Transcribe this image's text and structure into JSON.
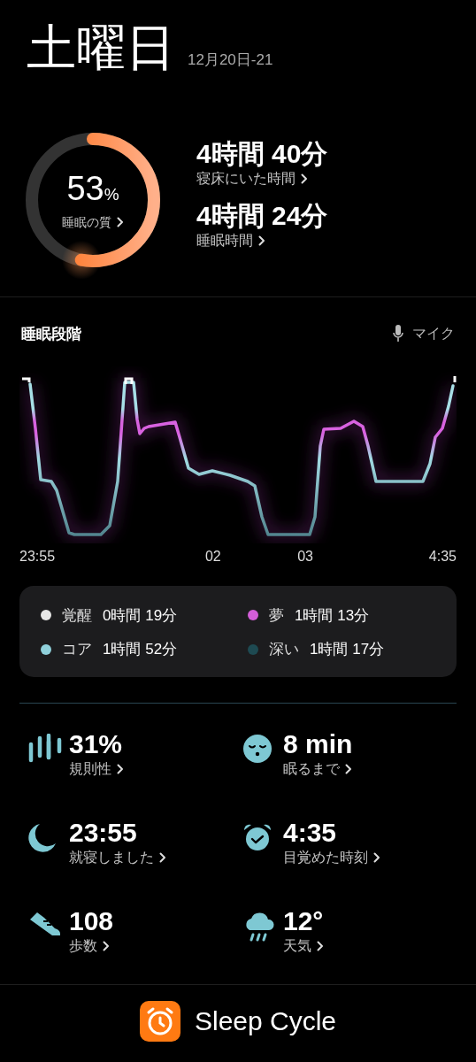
{
  "header": {
    "day": "土曜日",
    "date_range": "12月20日-21"
  },
  "quality": {
    "value": "53",
    "unit": "%",
    "label": "睡眠の質"
  },
  "durations": [
    {
      "value": "4時間 40分",
      "label": "寝床にいた時間"
    },
    {
      "value": "4時間 24分",
      "label": "睡眠時間"
    }
  ],
  "stages": {
    "title": "睡眠段階",
    "mic_label": "マイク",
    "time_labels": [
      "23:55",
      "02",
      "03",
      "4:35"
    ]
  },
  "legend": [
    {
      "name": "覚醒",
      "duration": "0時間 19分",
      "color": "#e6e6e6"
    },
    {
      "name": "夢",
      "duration": "1時間 13分",
      "color": "#d35ed8"
    },
    {
      "name": "コア",
      "duration": "1時間 52分",
      "color": "#8fd0da"
    },
    {
      "name": "深い",
      "duration": "1時間 17分",
      "color": "#1e4a52"
    }
  ],
  "stats": [
    {
      "kind": "regularity",
      "value": "31%",
      "label": "規則性"
    },
    {
      "kind": "fall_asleep",
      "value": "8 min",
      "label": "眠るまで"
    },
    {
      "kind": "bedtime",
      "value": "23:55",
      "label": "就寝しました"
    },
    {
      "kind": "wake",
      "value": "4:35",
      "label": "目覚めた時刻"
    },
    {
      "kind": "steps",
      "value": "108",
      "label": "歩数"
    },
    {
      "kind": "weather",
      "value": "12°",
      "label": "天気"
    }
  ],
  "footer": {
    "app_name": "Sleep Cycle"
  }
}
